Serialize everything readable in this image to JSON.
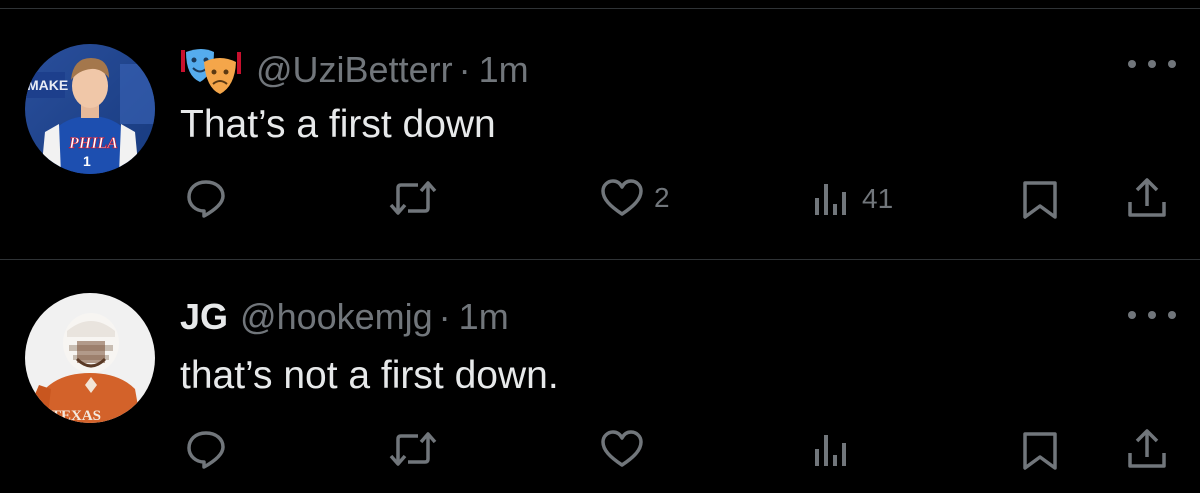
{
  "tweets": [
    {
      "display_name": "",
      "handle": "@UziBetterr",
      "separator": "·",
      "time": "1m",
      "text": "That’s a first down",
      "avatar": {
        "jersey_text": "PHILA",
        "jersey_number": "1",
        "banner_text": "MAKE"
      },
      "actions": {
        "reply_count": "",
        "retweet_count": "",
        "like_count": "2",
        "views_count": "41"
      }
    },
    {
      "display_name": "JG",
      "handle": "@hookemjg",
      "separator": "·",
      "time": "1m",
      "text": "that’s not a first down.",
      "avatar": {
        "jersey_text": "TEXAS"
      },
      "actions": {
        "reply_count": "",
        "retweet_count": "",
        "like_count": "",
        "views_count": ""
      }
    }
  ],
  "colors": {
    "background": "#000000",
    "text_primary": "#e7e9ea",
    "text_secondary": "#71767b",
    "divider": "#2f3336",
    "sixers_blue": "#1d62c8",
    "texas_orange": "#d3622a"
  },
  "icons": [
    "theater-masks-icon",
    "more-icon",
    "reply-icon",
    "retweet-icon",
    "like-icon",
    "views-icon",
    "bookmark-icon",
    "share-icon"
  ]
}
